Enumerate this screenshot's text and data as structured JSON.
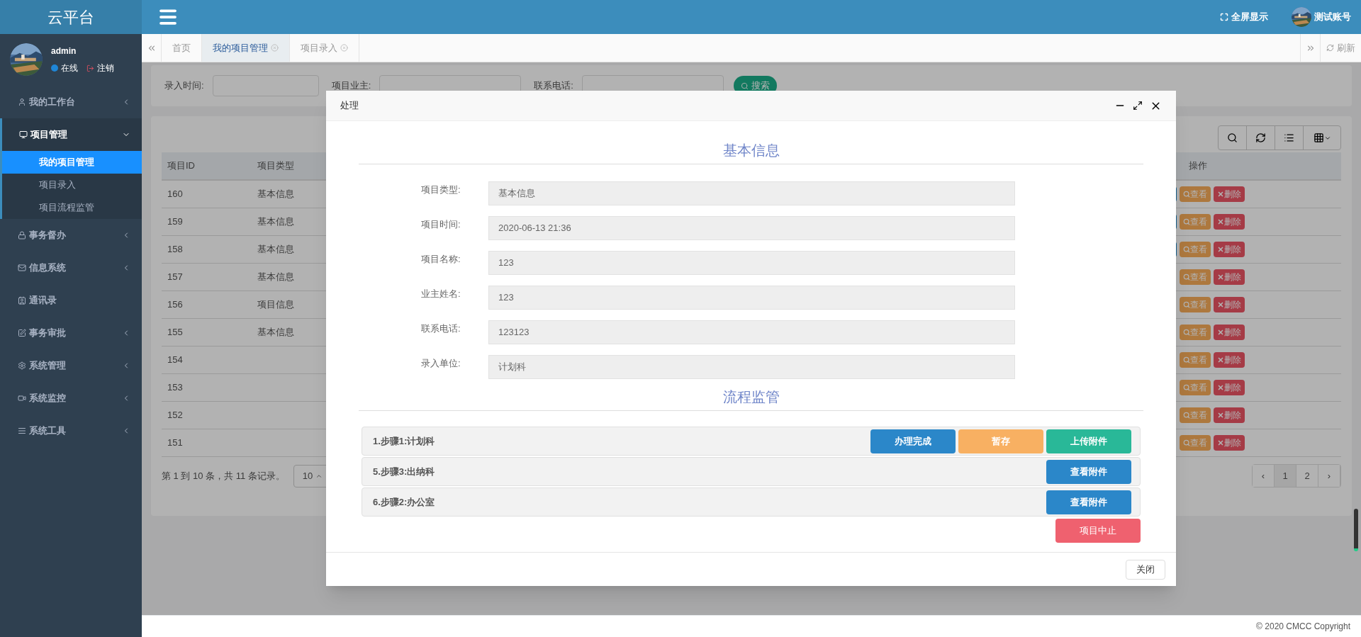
{
  "brand": "云平台",
  "user": {
    "name": "admin",
    "status": "在线",
    "logout": "注销"
  },
  "sidebar": {
    "items": [
      {
        "label": "我的工作台",
        "kind": "group",
        "expanded": false
      },
      {
        "label": "项目管理",
        "kind": "group",
        "expanded": true,
        "children": [
          {
            "label": "我的项目管理",
            "selected": true
          },
          {
            "label": "项目录入",
            "selected": false
          },
          {
            "label": "项目流程监管",
            "selected": false
          }
        ]
      },
      {
        "label": "事务督办",
        "kind": "group",
        "expanded": false
      },
      {
        "label": "信息系统",
        "kind": "group",
        "expanded": false
      },
      {
        "label": "通讯录",
        "kind": "link"
      },
      {
        "label": "事务审批",
        "kind": "group",
        "expanded": false
      },
      {
        "label": "系统管理",
        "kind": "group",
        "expanded": false
      },
      {
        "label": "系统监控",
        "kind": "group",
        "expanded": false
      },
      {
        "label": "系统工具",
        "kind": "group",
        "expanded": false
      }
    ]
  },
  "topbar": {
    "fullscreen": "全屏显示",
    "account": "测试账号"
  },
  "tabs": [
    {
      "label": "首页",
      "selected": false,
      "closable": false
    },
    {
      "label": "我的项目管理",
      "selected": true,
      "closable": true
    },
    {
      "label": "项目录入",
      "selected": false,
      "closable": true
    }
  ],
  "refresh": "刷新",
  "search": {
    "fields": [
      "录入时间:",
      "项目业主:",
      "联系电话:"
    ],
    "button": "搜索"
  },
  "table": {
    "columns": [
      "项目ID",
      "项目类型",
      "操作"
    ],
    "rows": [
      {
        "id": "160",
        "type": "基本信息",
        "edit_visible": true,
        "view": "查看",
        "delete": "删除"
      },
      {
        "id": "159",
        "type": "基本信息",
        "edit_visible": true,
        "view": "查看",
        "delete": "删除"
      },
      {
        "id": "158",
        "type": "基本信息",
        "edit_visible": true,
        "view": "查看",
        "delete": "删除"
      },
      {
        "id": "157",
        "type": "基本信息",
        "edit_visible": false,
        "view": "查看",
        "delete": "删除"
      },
      {
        "id": "156",
        "type": "项目信息",
        "edit_visible": false,
        "view": "查看",
        "delete": "删除"
      },
      {
        "id": "155",
        "type": "基本信息",
        "edit_visible": false,
        "view": "查看",
        "delete": "删除"
      },
      {
        "id": "154",
        "edit_visible": false,
        "view": "查看",
        "delete": "删除"
      },
      {
        "id": "153",
        "edit_visible": false,
        "view": "查看",
        "delete": "删除"
      },
      {
        "id": "152",
        "edit_visible": false,
        "view": "查看",
        "delete": "删除"
      },
      {
        "id": "151",
        "edit_visible": false,
        "view": "查看",
        "delete": "删除"
      }
    ]
  },
  "pagination": {
    "info": "第 1 到 10 条，共 11 条记录。",
    "page_size": "10",
    "pages": [
      {
        "label": "‹",
        "selected": false
      },
      {
        "label": "1",
        "selected": true
      },
      {
        "label": "2",
        "selected": false
      },
      {
        "label": "›",
        "selected": false
      }
    ]
  },
  "footer": "© 2020 CMCC Copyright",
  "modal": {
    "title": "处理",
    "basic": {
      "title": "基本信息",
      "fields": [
        {
          "label": "项目类型:",
          "value": "基本信息"
        },
        {
          "label": "项目时间:",
          "value": "2020-06-13 21:36"
        },
        {
          "label": "项目名称:",
          "value": "123"
        },
        {
          "label": "业主姓名:",
          "value": "123"
        },
        {
          "label": "联系电话:",
          "value": "123123"
        },
        {
          "label": "录入单位:",
          "value": "计划科"
        }
      ]
    },
    "process": {
      "title": "流程监管",
      "steps": [
        {
          "label": "1.步骤1:计划科",
          "buttons": [
            {
              "label": "办理完成",
              "kind": "primary"
            },
            {
              "label": "暂存",
              "kind": "warning"
            },
            {
              "label": "上传附件",
              "kind": "success"
            }
          ]
        },
        {
          "label": "5.步骤3:出纳科",
          "buttons": [
            {
              "label": "查看附件",
              "kind": "primary"
            }
          ]
        },
        {
          "label": "6.步骤2:办公室",
          "buttons": [
            {
              "label": "查看附件",
              "kind": "primary"
            }
          ]
        }
      ]
    },
    "abort_button": "项目中止",
    "close_button": "关闭"
  }
}
